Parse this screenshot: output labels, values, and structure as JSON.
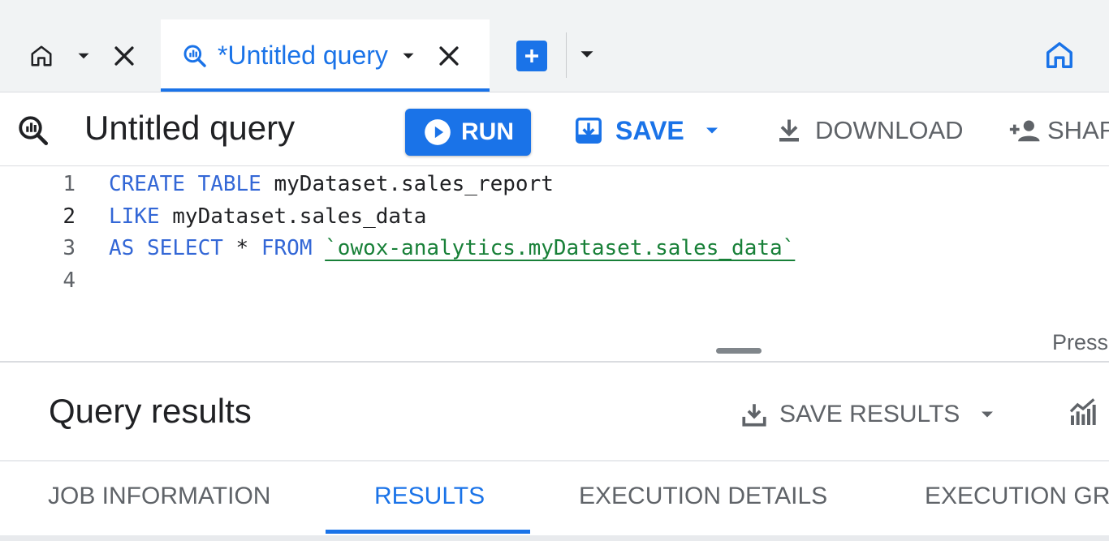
{
  "tabs": {
    "active_title": "*Untitled query"
  },
  "toolbar": {
    "title": "Untitled query",
    "run_label": "RUN",
    "save_label": "SAVE",
    "download_label": "DOWNLOAD",
    "share_label": "SHAR"
  },
  "editor": {
    "line_numbers": [
      "1",
      "2",
      "3",
      "4"
    ],
    "lines": [
      {
        "kw1": "CREATE TABLE",
        "rest": " myDataset.sales_report"
      },
      {
        "kw1": "LIKE",
        "rest": " myDataset.sales_data"
      },
      {
        "kw1": "AS SELECT",
        "mid": " * ",
        "kw2": "FROM",
        "sp": " ",
        "str": "`owox-analytics.myDataset.sales_data`"
      }
    ],
    "hint": "Press"
  },
  "results": {
    "title": "Query results",
    "save_results_label": "SAVE RESULTS",
    "tabs": [
      "JOB INFORMATION",
      "RESULTS",
      "EXECUTION DETAILS",
      "EXECUTION GRA"
    ],
    "active_tab": "RESULTS"
  },
  "colors": {
    "accent": "#1a73e8",
    "keyword": "#3367d6",
    "string": "#188038",
    "muted": "#5f6368"
  }
}
